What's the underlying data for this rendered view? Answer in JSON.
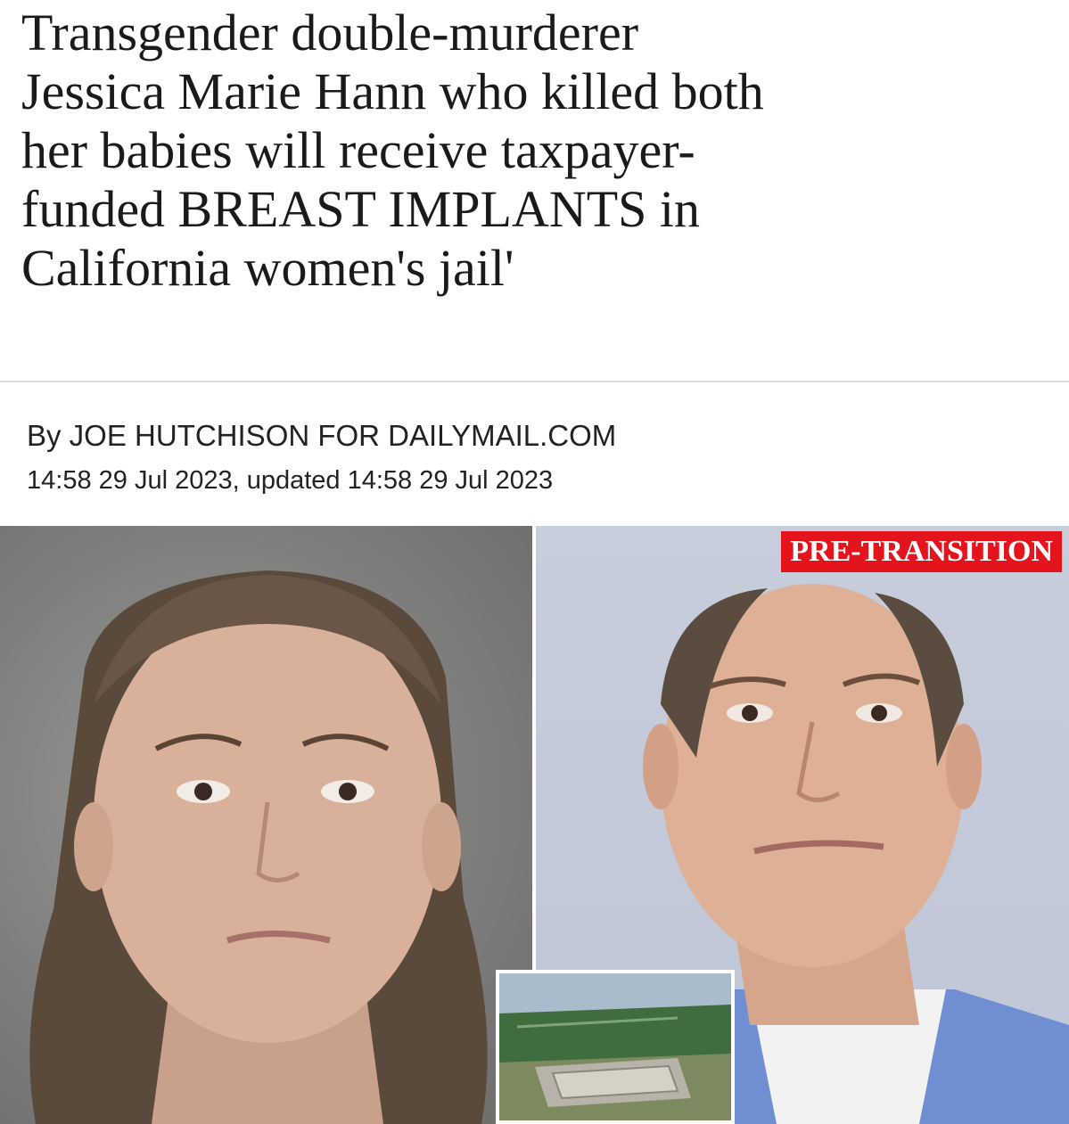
{
  "headline": {
    "lines": [
      "Transgender double-murderer",
      "Jessica Marie Hann who killed both",
      "her babies will receive taxpayer-",
      "funded BREAST IMPLANTS in",
      "California women's jail'"
    ]
  },
  "byline": "By JOE HUTCHISON FOR DAILYMAIL.COM",
  "dateline": "14:58 29 Jul 2023, updated 14:58 29 Jul 2023",
  "photos": {
    "right_badge": "PRE-TRANSITION"
  },
  "colors": {
    "badge_red": "#e3141b",
    "headline_text": "#1a1a1a"
  }
}
